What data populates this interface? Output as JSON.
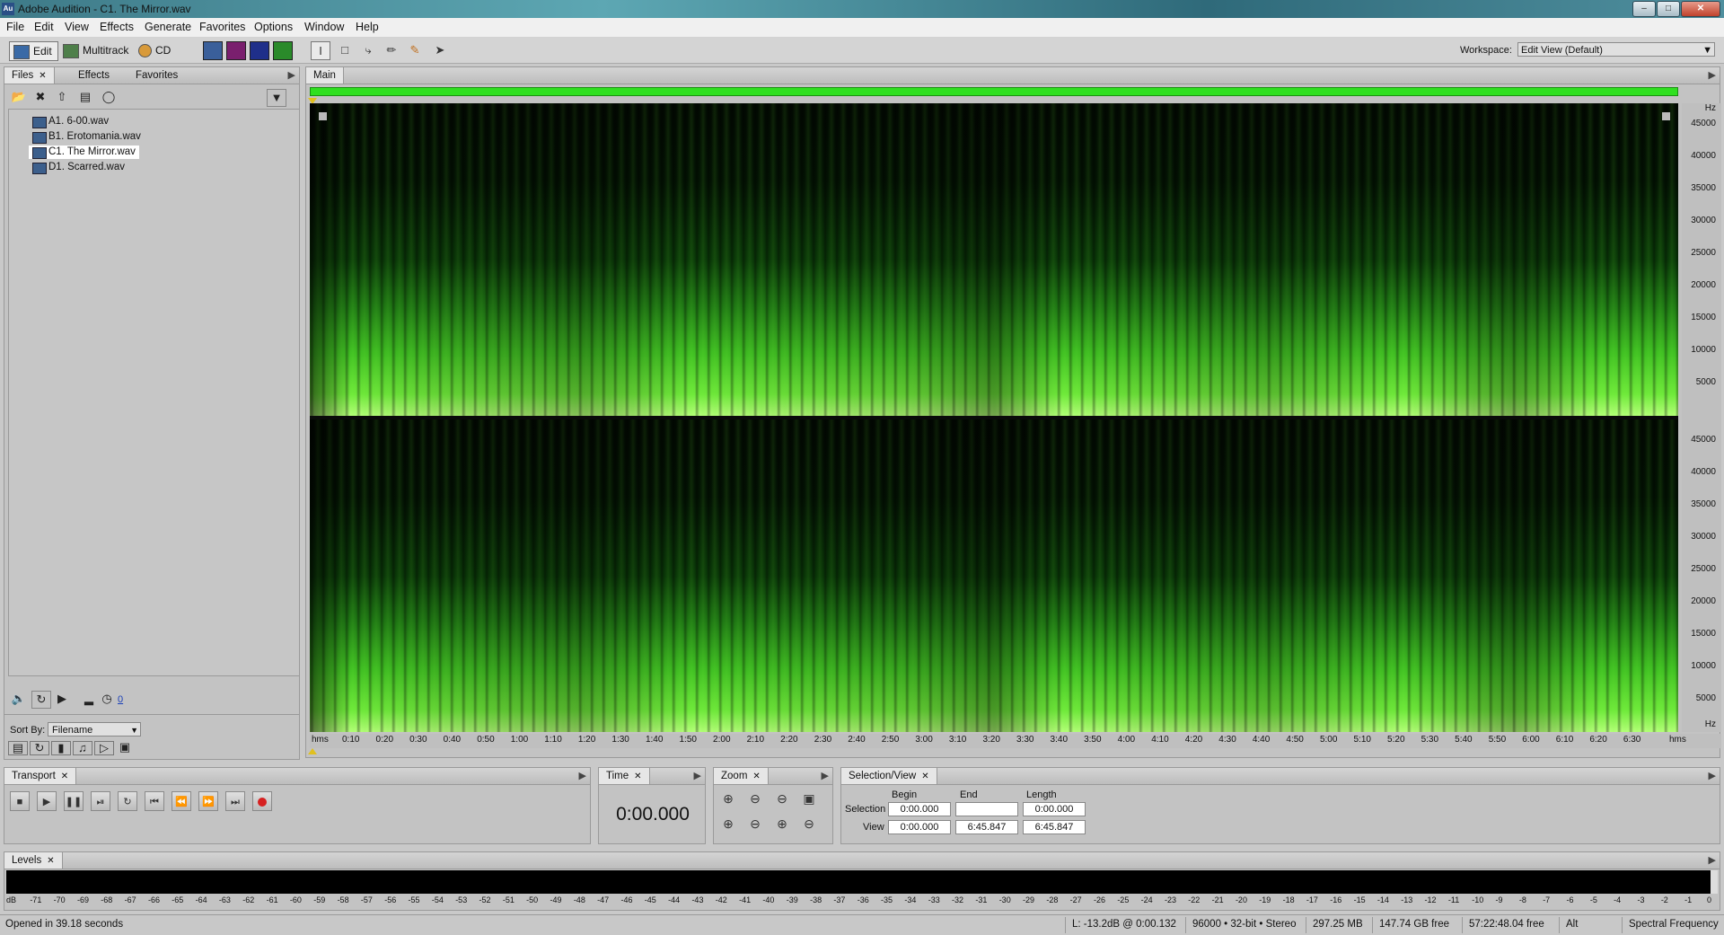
{
  "window": {
    "title": "Adobe Audition - C1. The Mirror.wav",
    "app_icon": "Au"
  },
  "menu": [
    "File",
    "Edit",
    "View",
    "Effects",
    "Generate",
    "Favorites",
    "Options",
    "Window",
    "Help"
  ],
  "toolbar": {
    "edit_label": "Edit",
    "multitrack_label": "Multitrack",
    "cd_label": "CD",
    "workspace_label": "Workspace:",
    "workspace_value": "Edit View (Default)"
  },
  "files_panel": {
    "tabs": [
      "Files",
      "Effects",
      "Favorites"
    ],
    "files": [
      "A1. 6-00.wav",
      "B1. Erotomania.wav",
      "C1. The Mirror.wav",
      "D1. Scarred.wav"
    ],
    "selected_index": 2,
    "volume_value": "0",
    "sort_by_label": "Sort By:",
    "sort_by_value": "Filename"
  },
  "editor": {
    "tab": "Main",
    "hz_unit": "Hz",
    "hz_labels": [
      "45000",
      "40000",
      "35000",
      "30000",
      "25000",
      "20000",
      "15000",
      "10000",
      "5000"
    ],
    "time_unit": "hms",
    "time_labels": [
      "0:10",
      "0:20",
      "0:30",
      "0:40",
      "0:50",
      "1:00",
      "1:10",
      "1:20",
      "1:30",
      "1:40",
      "1:50",
      "2:00",
      "2:10",
      "2:20",
      "2:30",
      "2:40",
      "2:50",
      "3:00",
      "3:10",
      "3:20",
      "3:30",
      "3:40",
      "3:50",
      "4:00",
      "4:10",
      "4:20",
      "4:30",
      "4:40",
      "4:50",
      "5:00",
      "5:10",
      "5:20",
      "5:30",
      "5:40",
      "5:50",
      "6:00",
      "6:10",
      "6:20",
      "6:30"
    ]
  },
  "transport": {
    "title": "Transport"
  },
  "time_panel": {
    "title": "Time",
    "value": "0:00.000"
  },
  "zoom_panel": {
    "title": "Zoom"
  },
  "selection_view": {
    "title": "Selection/View",
    "col_begin": "Begin",
    "col_end": "End",
    "col_length": "Length",
    "row_selection": "Selection",
    "row_view": "View",
    "selection_begin": "0:00.000",
    "selection_end": "",
    "selection_length": "0:00.000",
    "view_begin": "0:00.000",
    "view_end": "6:45.847",
    "view_length": "6:45.847"
  },
  "levels": {
    "title": "Levels",
    "db_labels": [
      "dB",
      "-71",
      "-70",
      "-69",
      "-68",
      "-67",
      "-66",
      "-65",
      "-64",
      "-63",
      "-62",
      "-61",
      "-60",
      "-59",
      "-58",
      "-57",
      "-56",
      "-55",
      "-54",
      "-53",
      "-52",
      "-51",
      "-50",
      "-49",
      "-48",
      "-47",
      "-46",
      "-45",
      "-44",
      "-43",
      "-42",
      "-41",
      "-40",
      "-39",
      "-38",
      "-37",
      "-36",
      "-35",
      "-34",
      "-33",
      "-32",
      "-31",
      "-30",
      "-29",
      "-28",
      "-27",
      "-26",
      "-25",
      "-24",
      "-23",
      "-22",
      "-21",
      "-20",
      "-19",
      "-18",
      "-17",
      "-16",
      "-15",
      "-14",
      "-13",
      "-12",
      "-11",
      "-10",
      "-9",
      "-8",
      "-7",
      "-6",
      "-5",
      "-4",
      "-3",
      "-2",
      "-1",
      "0"
    ]
  },
  "status": {
    "opened": "Opened in 39.18 seconds",
    "level_at": "L: -13.2dB @  0:00.132",
    "format": "96000 • 32-bit • Stereo",
    "size": "297.25 MB",
    "free": "147.74 GB free",
    "free_time": "57:22:48.04 free",
    "alt": "Alt",
    "view_mode": "Spectral Frequency"
  },
  "colors": {
    "spectrum": "#5cff2e",
    "playhead_bar": "#2fe020",
    "record": "#d62020"
  }
}
